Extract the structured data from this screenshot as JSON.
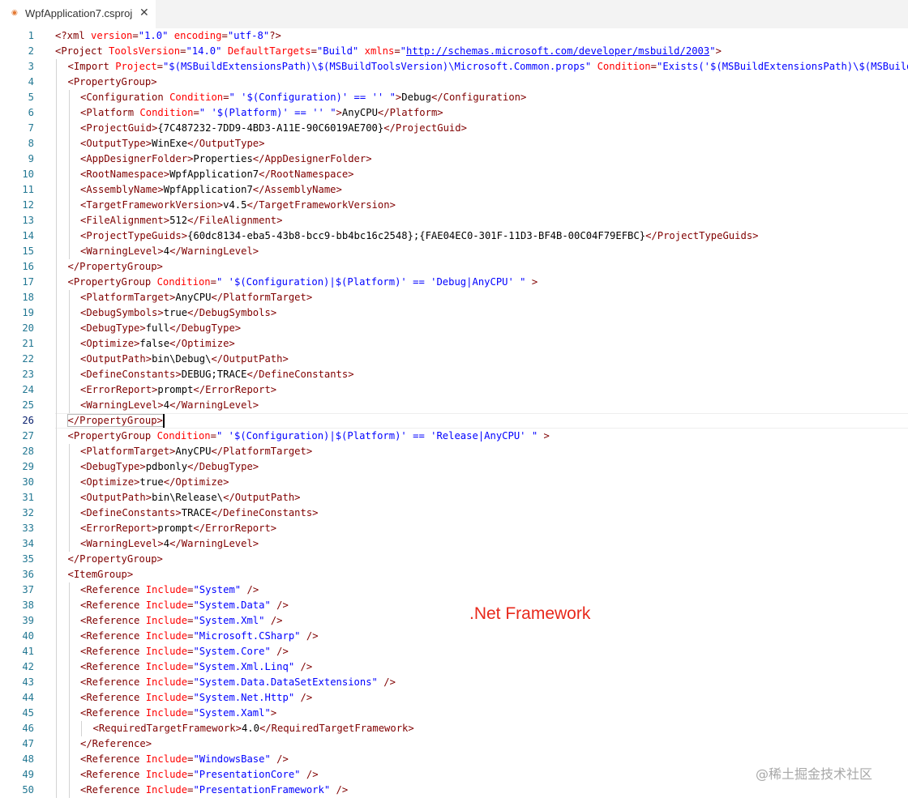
{
  "tab": {
    "title": "WpfApplication7.csproj",
    "icon": "rss-xml-file-icon",
    "close_glyph": "✕"
  },
  "editor": {
    "active_line": 26,
    "lines": [
      {
        "n": "1",
        "indent": 0,
        "t": [
          [
            "t",
            "<?xml"
          ],
          [
            "p",
            " "
          ],
          [
            "a",
            "version"
          ],
          [
            "t",
            "="
          ],
          [
            "v",
            "\"1.0\""
          ],
          [
            "p",
            " "
          ],
          [
            "a",
            "encoding"
          ],
          [
            "t",
            "="
          ],
          [
            "v",
            "\"utf-8\""
          ],
          [
            "t",
            "?>"
          ]
        ]
      },
      {
        "n": "2",
        "indent": 0,
        "t": [
          [
            "t",
            "<Project"
          ],
          [
            "p",
            " "
          ],
          [
            "a",
            "ToolsVersion"
          ],
          [
            "t",
            "="
          ],
          [
            "v",
            "\"14.0\""
          ],
          [
            "p",
            " "
          ],
          [
            "a",
            "DefaultTargets"
          ],
          [
            "t",
            "="
          ],
          [
            "v",
            "\"Build\""
          ],
          [
            "p",
            " "
          ],
          [
            "a",
            "xmlns"
          ],
          [
            "t",
            "="
          ],
          [
            "v",
            "\""
          ],
          [
            "u",
            "http://schemas.microsoft.com/developer/msbuild/2003"
          ],
          [
            "v",
            "\""
          ],
          [
            "t",
            ">"
          ]
        ]
      },
      {
        "n": "3",
        "indent": 1,
        "t": [
          [
            "t",
            "<Import"
          ],
          [
            "p",
            " "
          ],
          [
            "a",
            "Project"
          ],
          [
            "t",
            "="
          ],
          [
            "v",
            "\"$(MSBuildExtensionsPath)\\$(MSBuildToolsVersion)\\Microsoft.Common.props\""
          ],
          [
            "p",
            " "
          ],
          [
            "a",
            "Condition"
          ],
          [
            "t",
            "="
          ],
          [
            "v",
            "\"Exists('$(MSBuildExtensionsPath)\\$(MSBuildToolsVersion)\\Microsoft.Common.props')\""
          ],
          [
            "p",
            " "
          ],
          [
            "t",
            "/>"
          ]
        ]
      },
      {
        "n": "4",
        "indent": 1,
        "t": [
          [
            "t",
            "<PropertyGroup>"
          ]
        ]
      },
      {
        "n": "5",
        "indent": 2,
        "t": [
          [
            "t",
            "<Configuration"
          ],
          [
            "p",
            " "
          ],
          [
            "a",
            "Condition"
          ],
          [
            "t",
            "="
          ],
          [
            "v",
            "\" '$(Configuration)' == '' \""
          ],
          [
            "t",
            ">"
          ],
          [
            "p",
            "Debug"
          ],
          [
            "t",
            "</Configuration>"
          ]
        ]
      },
      {
        "n": "6",
        "indent": 2,
        "t": [
          [
            "t",
            "<Platform"
          ],
          [
            "p",
            " "
          ],
          [
            "a",
            "Condition"
          ],
          [
            "t",
            "="
          ],
          [
            "v",
            "\" '$(Platform)' == '' \""
          ],
          [
            "t",
            ">"
          ],
          [
            "p",
            "AnyCPU"
          ],
          [
            "t",
            "</Platform>"
          ]
        ]
      },
      {
        "n": "7",
        "indent": 2,
        "t": [
          [
            "t",
            "<ProjectGuid>"
          ],
          [
            "p",
            "{7C487232-7DD9-4BD3-A11E-90C6019AE700}"
          ],
          [
            "t",
            "</ProjectGuid>"
          ]
        ]
      },
      {
        "n": "8",
        "indent": 2,
        "t": [
          [
            "t",
            "<OutputType>"
          ],
          [
            "p",
            "WinExe"
          ],
          [
            "t",
            "</OutputType>"
          ]
        ]
      },
      {
        "n": "9",
        "indent": 2,
        "t": [
          [
            "t",
            "<AppDesignerFolder>"
          ],
          [
            "p",
            "Properties"
          ],
          [
            "t",
            "</AppDesignerFolder>"
          ]
        ]
      },
      {
        "n": "10",
        "indent": 2,
        "t": [
          [
            "t",
            "<RootNamespace>"
          ],
          [
            "p",
            "WpfApplication7"
          ],
          [
            "t",
            "</RootNamespace>"
          ]
        ]
      },
      {
        "n": "11",
        "indent": 2,
        "t": [
          [
            "t",
            "<AssemblyName>"
          ],
          [
            "p",
            "WpfApplication7"
          ],
          [
            "t",
            "</AssemblyName>"
          ]
        ]
      },
      {
        "n": "12",
        "indent": 2,
        "t": [
          [
            "t",
            "<TargetFrameworkVersion>"
          ],
          [
            "p",
            "v4.5"
          ],
          [
            "t",
            "</TargetFrameworkVersion>"
          ]
        ]
      },
      {
        "n": "13",
        "indent": 2,
        "t": [
          [
            "t",
            "<FileAlignment>"
          ],
          [
            "p",
            "512"
          ],
          [
            "t",
            "</FileAlignment>"
          ]
        ]
      },
      {
        "n": "14",
        "indent": 2,
        "t": [
          [
            "t",
            "<ProjectTypeGuids>"
          ],
          [
            "p",
            "{60dc8134-eba5-43b8-bcc9-bb4bc16c2548};{FAE04EC0-301F-11D3-BF4B-00C04F79EFBC}"
          ],
          [
            "t",
            "</ProjectTypeGuids>"
          ]
        ]
      },
      {
        "n": "15",
        "indent": 2,
        "t": [
          [
            "t",
            "<WarningLevel>"
          ],
          [
            "p",
            "4"
          ],
          [
            "t",
            "</WarningLevel>"
          ]
        ]
      },
      {
        "n": "16",
        "indent": 1,
        "t": [
          [
            "t",
            "</PropertyGroup>"
          ]
        ]
      },
      {
        "n": "17",
        "indent": 1,
        "t": [
          [
            "t",
            "<PropertyGroup"
          ],
          [
            "p",
            " "
          ],
          [
            "a",
            "Condition"
          ],
          [
            "t",
            "="
          ],
          [
            "v",
            "\" '$(Configuration)|$(Platform)' == 'Debug|AnyCPU' \""
          ],
          [
            "p",
            " "
          ],
          [
            "t",
            ">"
          ]
        ]
      },
      {
        "n": "18",
        "indent": 2,
        "t": [
          [
            "t",
            "<PlatformTarget>"
          ],
          [
            "p",
            "AnyCPU"
          ],
          [
            "t",
            "</PlatformTarget>"
          ]
        ]
      },
      {
        "n": "19",
        "indent": 2,
        "t": [
          [
            "t",
            "<DebugSymbols>"
          ],
          [
            "p",
            "true"
          ],
          [
            "t",
            "</DebugSymbols>"
          ]
        ]
      },
      {
        "n": "20",
        "indent": 2,
        "t": [
          [
            "t",
            "<DebugType>"
          ],
          [
            "p",
            "full"
          ],
          [
            "t",
            "</DebugType>"
          ]
        ]
      },
      {
        "n": "21",
        "indent": 2,
        "t": [
          [
            "t",
            "<Optimize>"
          ],
          [
            "p",
            "false"
          ],
          [
            "t",
            "</Optimize>"
          ]
        ]
      },
      {
        "n": "22",
        "indent": 2,
        "t": [
          [
            "t",
            "<OutputPath>"
          ],
          [
            "p",
            "bin\\Debug\\"
          ],
          [
            "t",
            "</OutputPath>"
          ]
        ]
      },
      {
        "n": "23",
        "indent": 2,
        "t": [
          [
            "t",
            "<DefineConstants>"
          ],
          [
            "p",
            "DEBUG;TRACE"
          ],
          [
            "t",
            "</DefineConstants>"
          ]
        ]
      },
      {
        "n": "24",
        "indent": 2,
        "t": [
          [
            "t",
            "<ErrorReport>"
          ],
          [
            "p",
            "prompt"
          ],
          [
            "t",
            "</ErrorReport>"
          ]
        ]
      },
      {
        "n": "25",
        "indent": 2,
        "t": [
          [
            "t",
            "<WarningLevel>"
          ],
          [
            "p",
            "4"
          ],
          [
            "t",
            "</WarningLevel>"
          ]
        ]
      },
      {
        "n": "26",
        "indent": 1,
        "t": [
          [
            "t",
            "</PropertyGroup>"
          ]
        ]
      },
      {
        "n": "27",
        "indent": 1,
        "t": [
          [
            "t",
            "<PropertyGroup"
          ],
          [
            "p",
            " "
          ],
          [
            "a",
            "Condition"
          ],
          [
            "t",
            "="
          ],
          [
            "v",
            "\" '$(Configuration)|$(Platform)' == 'Release|AnyCPU' \""
          ],
          [
            "p",
            " "
          ],
          [
            "t",
            ">"
          ]
        ]
      },
      {
        "n": "28",
        "indent": 2,
        "t": [
          [
            "t",
            "<PlatformTarget>"
          ],
          [
            "p",
            "AnyCPU"
          ],
          [
            "t",
            "</PlatformTarget>"
          ]
        ]
      },
      {
        "n": "29",
        "indent": 2,
        "t": [
          [
            "t",
            "<DebugType>"
          ],
          [
            "p",
            "pdbonly"
          ],
          [
            "t",
            "</DebugType>"
          ]
        ]
      },
      {
        "n": "30",
        "indent": 2,
        "t": [
          [
            "t",
            "<Optimize>"
          ],
          [
            "p",
            "true"
          ],
          [
            "t",
            "</Optimize>"
          ]
        ]
      },
      {
        "n": "31",
        "indent": 2,
        "t": [
          [
            "t",
            "<OutputPath>"
          ],
          [
            "p",
            "bin\\Release\\"
          ],
          [
            "t",
            "</OutputPath>"
          ]
        ]
      },
      {
        "n": "32",
        "indent": 2,
        "t": [
          [
            "t",
            "<DefineConstants>"
          ],
          [
            "p",
            "TRACE"
          ],
          [
            "t",
            "</DefineConstants>"
          ]
        ]
      },
      {
        "n": "33",
        "indent": 2,
        "t": [
          [
            "t",
            "<ErrorReport>"
          ],
          [
            "p",
            "prompt"
          ],
          [
            "t",
            "</ErrorReport>"
          ]
        ]
      },
      {
        "n": "34",
        "indent": 2,
        "t": [
          [
            "t",
            "<WarningLevel>"
          ],
          [
            "p",
            "4"
          ],
          [
            "t",
            "</WarningLevel>"
          ]
        ]
      },
      {
        "n": "35",
        "indent": 1,
        "t": [
          [
            "t",
            "</PropertyGroup>"
          ]
        ]
      },
      {
        "n": "36",
        "indent": 1,
        "t": [
          [
            "t",
            "<ItemGroup>"
          ]
        ]
      },
      {
        "n": "37",
        "indent": 2,
        "t": [
          [
            "t",
            "<Reference"
          ],
          [
            "p",
            " "
          ],
          [
            "a",
            "Include"
          ],
          [
            "t",
            "="
          ],
          [
            "v",
            "\"System\""
          ],
          [
            "p",
            " "
          ],
          [
            "t",
            "/>"
          ]
        ]
      },
      {
        "n": "38",
        "indent": 2,
        "t": [
          [
            "t",
            "<Reference"
          ],
          [
            "p",
            " "
          ],
          [
            "a",
            "Include"
          ],
          [
            "t",
            "="
          ],
          [
            "v",
            "\"System.Data\""
          ],
          [
            "p",
            " "
          ],
          [
            "t",
            "/>"
          ]
        ]
      },
      {
        "n": "39",
        "indent": 2,
        "t": [
          [
            "t",
            "<Reference"
          ],
          [
            "p",
            " "
          ],
          [
            "a",
            "Include"
          ],
          [
            "t",
            "="
          ],
          [
            "v",
            "\"System.Xml\""
          ],
          [
            "p",
            " "
          ],
          [
            "t",
            "/>"
          ]
        ]
      },
      {
        "n": "40",
        "indent": 2,
        "t": [
          [
            "t",
            "<Reference"
          ],
          [
            "p",
            " "
          ],
          [
            "a",
            "Include"
          ],
          [
            "t",
            "="
          ],
          [
            "v",
            "\"Microsoft.CSharp\""
          ],
          [
            "p",
            " "
          ],
          [
            "t",
            "/>"
          ]
        ]
      },
      {
        "n": "41",
        "indent": 2,
        "t": [
          [
            "t",
            "<Reference"
          ],
          [
            "p",
            " "
          ],
          [
            "a",
            "Include"
          ],
          [
            "t",
            "="
          ],
          [
            "v",
            "\"System.Core\""
          ],
          [
            "p",
            " "
          ],
          [
            "t",
            "/>"
          ]
        ]
      },
      {
        "n": "42",
        "indent": 2,
        "t": [
          [
            "t",
            "<Reference"
          ],
          [
            "p",
            " "
          ],
          [
            "a",
            "Include"
          ],
          [
            "t",
            "="
          ],
          [
            "v",
            "\"System.Xml.Linq\""
          ],
          [
            "p",
            " "
          ],
          [
            "t",
            "/>"
          ]
        ]
      },
      {
        "n": "43",
        "indent": 2,
        "t": [
          [
            "t",
            "<Reference"
          ],
          [
            "p",
            " "
          ],
          [
            "a",
            "Include"
          ],
          [
            "t",
            "="
          ],
          [
            "v",
            "\"System.Data.DataSetExtensions\""
          ],
          [
            "p",
            " "
          ],
          [
            "t",
            "/>"
          ]
        ]
      },
      {
        "n": "44",
        "indent": 2,
        "t": [
          [
            "t",
            "<Reference"
          ],
          [
            "p",
            " "
          ],
          [
            "a",
            "Include"
          ],
          [
            "t",
            "="
          ],
          [
            "v",
            "\"System.Net.Http\""
          ],
          [
            "p",
            " "
          ],
          [
            "t",
            "/>"
          ]
        ]
      },
      {
        "n": "45",
        "indent": 2,
        "t": [
          [
            "t",
            "<Reference"
          ],
          [
            "p",
            " "
          ],
          [
            "a",
            "Include"
          ],
          [
            "t",
            "="
          ],
          [
            "v",
            "\"System.Xaml\""
          ],
          [
            "t",
            ">"
          ]
        ]
      },
      {
        "n": "46",
        "indent": 3,
        "t": [
          [
            "t",
            "<RequiredTargetFramework>"
          ],
          [
            "p",
            "4.0"
          ],
          [
            "t",
            "</RequiredTargetFramework>"
          ]
        ]
      },
      {
        "n": "47",
        "indent": 2,
        "t": [
          [
            "t",
            "</Reference>"
          ]
        ]
      },
      {
        "n": "48",
        "indent": 2,
        "t": [
          [
            "t",
            "<Reference"
          ],
          [
            "p",
            " "
          ],
          [
            "a",
            "Include"
          ],
          [
            "t",
            "="
          ],
          [
            "v",
            "\"WindowsBase\""
          ],
          [
            "p",
            " "
          ],
          [
            "t",
            "/>"
          ]
        ]
      },
      {
        "n": "49",
        "indent": 2,
        "t": [
          [
            "t",
            "<Reference"
          ],
          [
            "p",
            " "
          ],
          [
            "a",
            "Include"
          ],
          [
            "t",
            "="
          ],
          [
            "v",
            "\"PresentationCore\""
          ],
          [
            "p",
            " "
          ],
          [
            "t",
            "/>"
          ]
        ]
      },
      {
        "n": "50",
        "indent": 2,
        "t": [
          [
            "t",
            "<Reference"
          ],
          [
            "p",
            " "
          ],
          [
            "a",
            "Include"
          ],
          [
            "t",
            "="
          ],
          [
            "v",
            "\"PresentationFramework\""
          ],
          [
            "p",
            " "
          ],
          [
            "t",
            "/>"
          ]
        ]
      }
    ]
  },
  "annotation": ".Net Framework",
  "watermark": "@稀土掘金技术社区",
  "colors": {
    "tag": "#800000",
    "attribute": "#ff0000",
    "value": "#0000ff",
    "line_number": "#237893",
    "annotation": "#e8291c"
  }
}
